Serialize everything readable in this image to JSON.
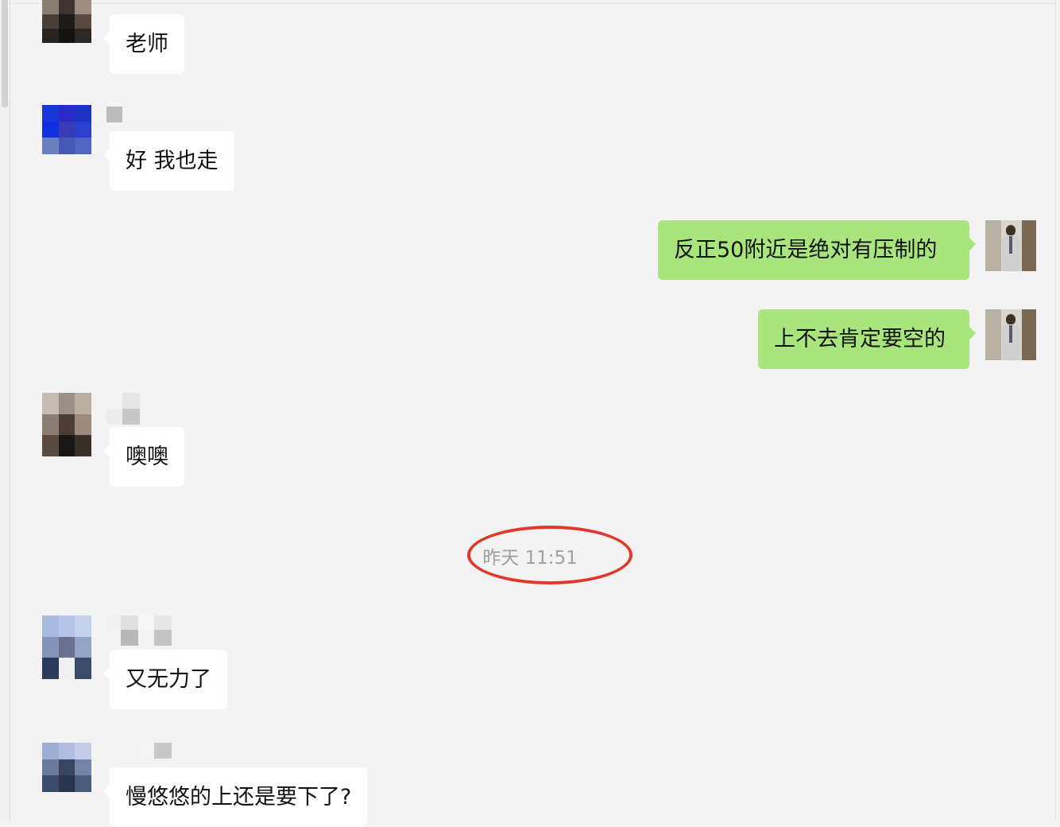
{
  "conversation": {
    "messages": [
      {
        "id": "m1",
        "side": "incoming",
        "text": "老师"
      },
      {
        "id": "m2",
        "side": "incoming",
        "text": "好 我也走"
      },
      {
        "id": "m3",
        "side": "outgoing",
        "text": "反正50附近是绝对有压制的"
      },
      {
        "id": "m4",
        "side": "outgoing",
        "text": "上不去肯定要空的"
      },
      {
        "id": "m5",
        "side": "incoming",
        "text": "噢噢"
      },
      {
        "id": "m6",
        "side": "incoming",
        "text": "又无力了"
      },
      {
        "id": "m7",
        "side": "incoming",
        "text": "慢悠悠的上还是要下了?"
      }
    ],
    "timestamp": "昨天 11:51"
  },
  "colors": {
    "outgoing_bubble": "#a8e57c",
    "incoming_bubble": "#ffffff",
    "background": "#f3f3f3",
    "annotation": "#e0392a"
  }
}
